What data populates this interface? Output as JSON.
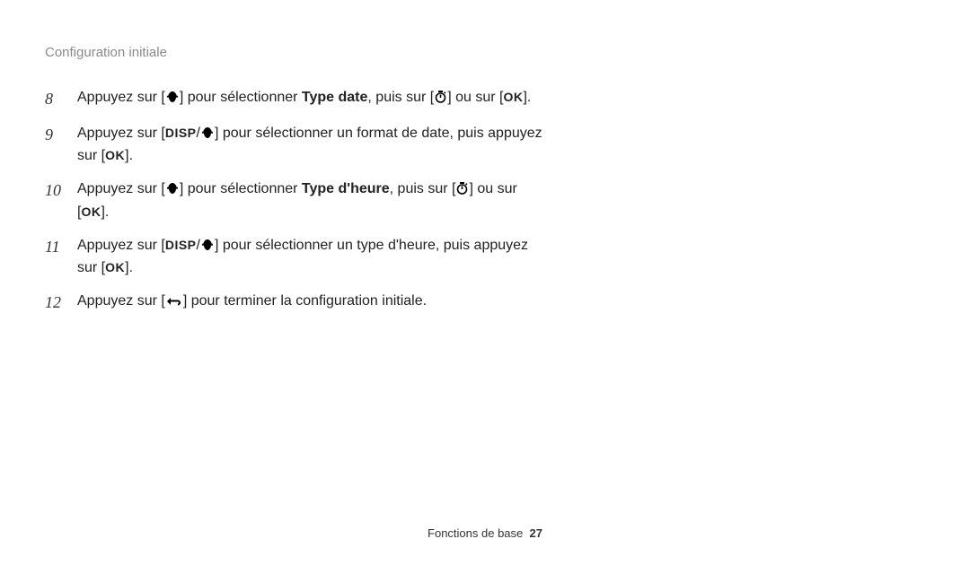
{
  "header": {
    "title": "Configuration initiale"
  },
  "icons": {
    "disp": "DISP",
    "ok": "OK"
  },
  "steps": [
    {
      "n": "8",
      "pre": "Appuyez sur [",
      "after_macro": "] pour sélectionner ",
      "bold": "Type date",
      "post_bold": ", puis sur [",
      "after_timer": "] ou sur [",
      "tail": "]."
    },
    {
      "n": "9",
      "pre": "Appuyez sur [",
      "mid": "/",
      "after_macro": "] pour sélectionner un format de date, puis appuyez sur [",
      "tail": "]."
    },
    {
      "n": "10",
      "pre": "Appuyez sur [",
      "after_macro": "] pour sélectionner ",
      "bold": "Type d'heure",
      "post_bold": ", puis sur [",
      "after_timer": "] ou sur [",
      "tail": "]."
    },
    {
      "n": "11",
      "pre": "Appuyez sur [",
      "mid": "/",
      "after_macro": "] pour sélectionner un type d'heure, puis appuyez sur [",
      "tail": "]."
    },
    {
      "n": "12",
      "pre": "Appuyez sur [",
      "after_back": "] pour terminer la configuration initiale."
    }
  ],
  "footer": {
    "section": "Fonctions de base",
    "page": "27"
  }
}
